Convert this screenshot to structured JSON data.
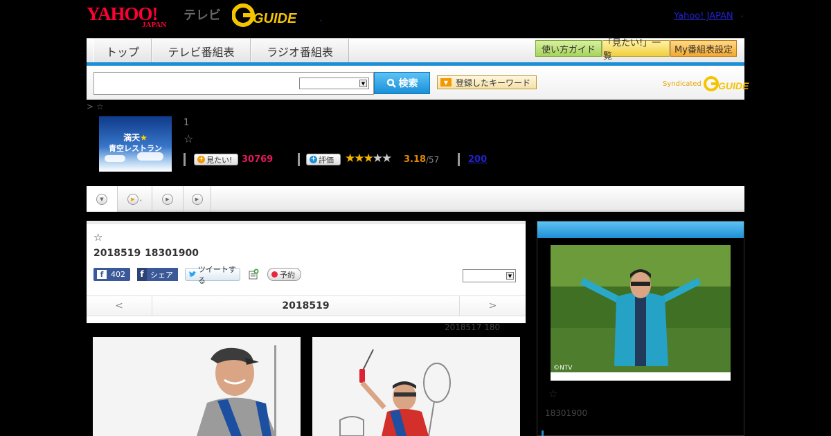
{
  "header": {
    "yahoo_logo": "YAHOO!",
    "yahoo_sub": "JAPAN",
    "tv_label": "テレビ",
    "gguide_logo": "GUIDE",
    "yahoo_japan_link": "Yahoo! JAPAN",
    "sep_dot": ",",
    "sep_dot2": ","
  },
  "nav": {
    "tabs": [
      "トップ",
      "テレビ番組表",
      "ラジオ番組表"
    ],
    "buttons": [
      "使い方ガイド",
      "「見たい!」一覧",
      "My番組表設定"
    ]
  },
  "search": {
    "input_value": "",
    "select_value": "",
    "search_button": "検索",
    "keyword_button": "登録したキーワード",
    "syndicated": "Syndicated"
  },
  "program": {
    "breadcrumb": "> ☆",
    "thumb_line1": "満天",
    "thumb_line2": "青空レストラン",
    "number": "1",
    "star": "☆",
    "mitai_button": "見たい!",
    "mitai_count": "30769",
    "hyoka_button": "評価",
    "rating_value": 3.18,
    "rating_text": "3.18",
    "rating_count": "/57",
    "review_link": "200",
    "star_full": "★★★",
    "star_empty": "★★"
  },
  "tabs_row": {
    "tab2_label": ","
  },
  "main": {
    "star": "☆",
    "date": "2018519",
    "time": "18301900",
    "fb_like_count": "402",
    "fb_share": "シェア",
    "tweet": "ツイートする",
    "yoyaku": "予約",
    "select_value": "",
    "prev": "<",
    "datenav_date": "2018519",
    "next": ">",
    "update_note": "2018517  180"
  },
  "right": {
    "img_credit": "©NTV",
    "star": "☆",
    "time": "18301900"
  },
  "colors": {
    "accent_blue": "#1e8fd6",
    "mitai_red": "#e6195a",
    "rating_orange": "#e08a00"
  }
}
